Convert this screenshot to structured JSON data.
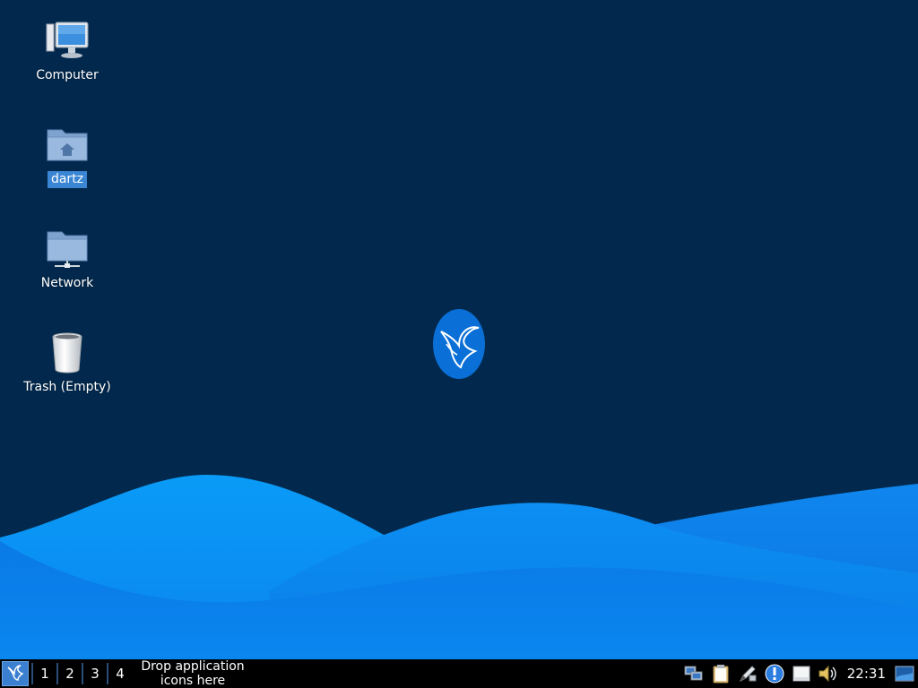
{
  "desktop": {
    "icons": [
      {
        "label": "Computer",
        "icon": "computer-icon",
        "selected": false
      },
      {
        "label": "dartz",
        "icon": "home-folder-icon",
        "selected": true
      },
      {
        "label": "Network",
        "icon": "network-folder-icon",
        "selected": false
      },
      {
        "label": "Trash (Empty)",
        "icon": "trash-icon",
        "selected": false
      }
    ],
    "center_logo": "hummingbird-logo-icon"
  },
  "taskbar": {
    "start_icon": "hummingbird-menu-icon",
    "workspaces": [
      "1",
      "2",
      "3",
      "4"
    ],
    "drop_hint": "Drop application icons here",
    "tray_icons": [
      "network-icon",
      "clipboard-icon",
      "pen-icon",
      "info-icon",
      "removable-drive-icon",
      "volume-icon"
    ],
    "clock": "22:31",
    "show_desktop_icon": "show-desktop-icon"
  },
  "colors": {
    "background": "#02294d",
    "wave_light": "#0a8ff5",
    "wave_mid": "#0777e6",
    "selection": "#3a86d4",
    "taskbar": "#000000"
  }
}
